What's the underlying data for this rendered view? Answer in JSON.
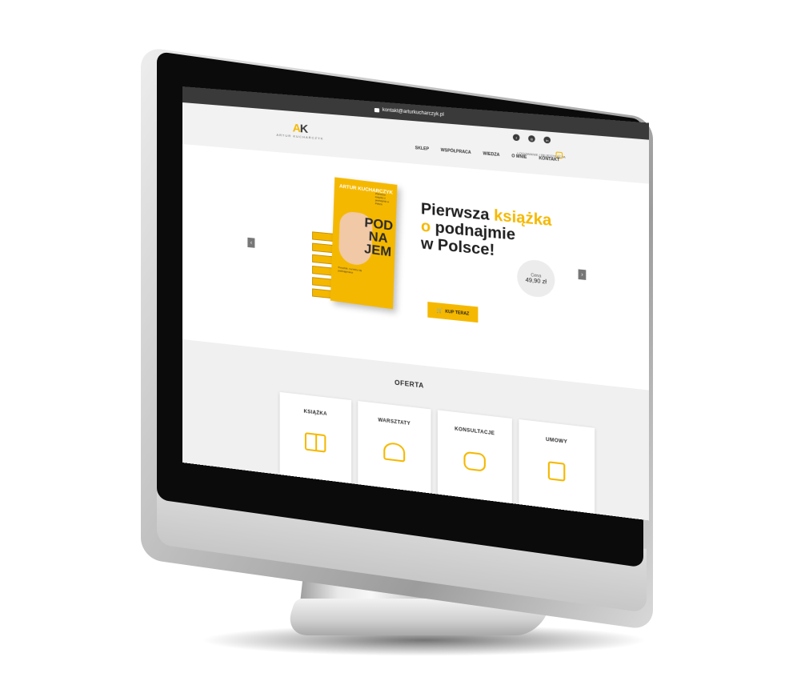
{
  "topbar": {
    "email": "kontakt@arturkucharczyk.pl"
  },
  "header": {
    "logo_mark": "AK",
    "logo_text": "ARTUR KUCHARCZYK",
    "social": [
      "f",
      "◎",
      "in"
    ],
    "login_link": "LOGOWANIE / REJESTRACJA",
    "nav": [
      "SKLEP",
      "WSPÓŁPRACA",
      "WIEDZA",
      "O MNIE",
      "KONTAKT"
    ]
  },
  "hero": {
    "book": {
      "author": "ARTUR KUCHARCZYK",
      "title_lines": [
        "POD",
        "NA",
        "JEM"
      ],
      "side_text": "Pierwsza książka o podnajmie w Polsce",
      "subtitle": "Poradnik, na który się podnajęmiesz"
    },
    "headline": {
      "line1_a": "Pierwsza ",
      "line1_accent": "książka",
      "line2_accent": "o ",
      "line2_b": "podnajmie",
      "line3": "w Polsce!"
    },
    "price_label": "Cena",
    "price_value": "49,90 zł",
    "buy_button": "KUP TERAZ",
    "prev_arrow": "‹",
    "next_arrow": "›"
  },
  "offer": {
    "title": "OFERTA",
    "cards": [
      {
        "label": "KSIĄŻKA",
        "icon": "book-icon"
      },
      {
        "label": "WARSZTATY",
        "icon": "people-icon"
      },
      {
        "label": "KONSULTACJE",
        "icon": "chat-icon"
      },
      {
        "label": "UMOWY",
        "icon": "document-icon"
      }
    ]
  },
  "colors": {
    "accent": "#f5b800",
    "topbar": "#3a3a3a",
    "offer_bg": "#f0f0f0"
  }
}
